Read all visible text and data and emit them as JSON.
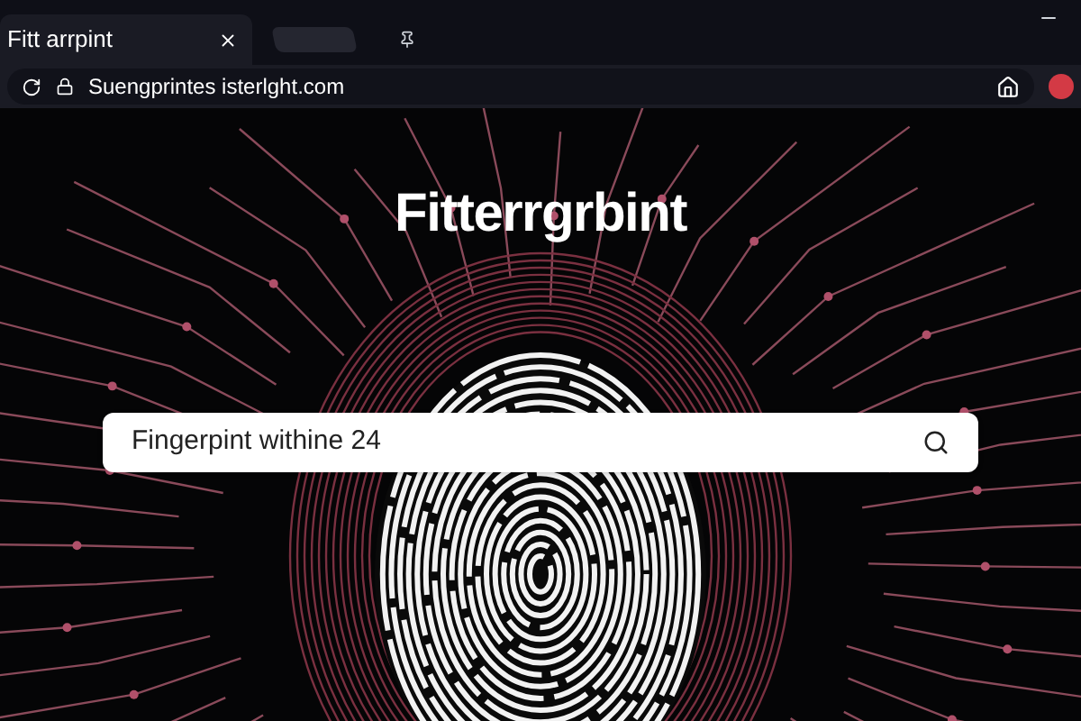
{
  "browser": {
    "tab": {
      "title": "Fitt arrpint",
      "selected": true
    },
    "url": "Suengprintes isterlght.com"
  },
  "page": {
    "heading": "Fitterrgrbint",
    "search": {
      "value": "Fingerpint withine 24"
    }
  }
}
